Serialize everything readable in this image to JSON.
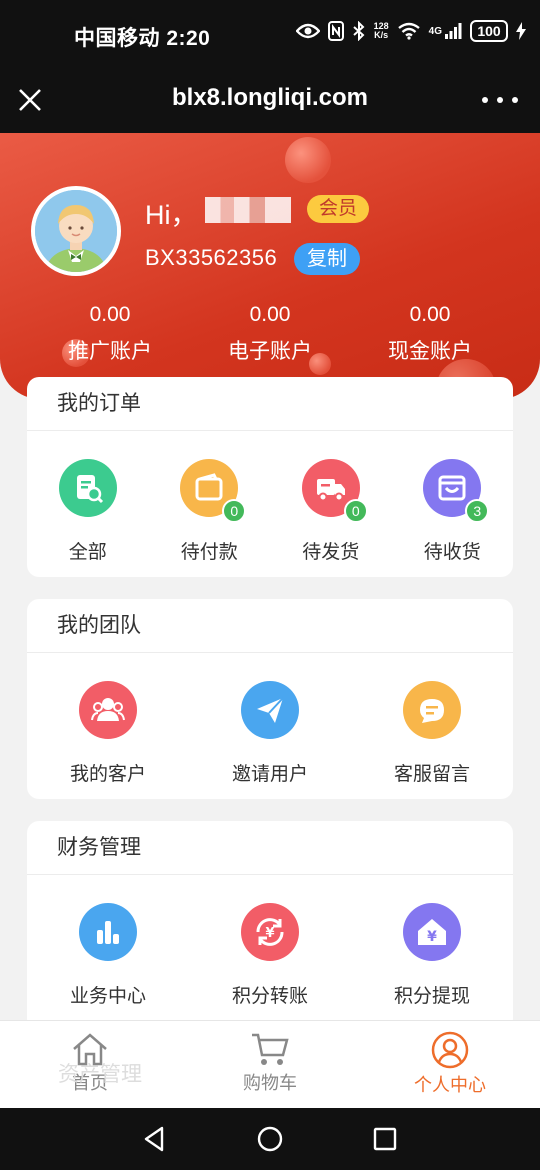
{
  "status_bar": {
    "carrier_time": "中国移动 2:20",
    "speed_top": "128",
    "speed_bottom": "K/s",
    "network": "4G",
    "battery": "100"
  },
  "browser": {
    "url": "blx8.longliqi.com"
  },
  "profile": {
    "greeting": "Hi，",
    "member_badge": "会员",
    "user_id": "BX33562356",
    "copy_label": "复制"
  },
  "accounts": [
    {
      "amount": "0.00",
      "label": "推广账户"
    },
    {
      "amount": "0.00",
      "label": "电子账户"
    },
    {
      "amount": "0.00",
      "label": "现金账户"
    }
  ],
  "orders": {
    "title": "我的订单",
    "items": [
      {
        "label": "全部",
        "icon": "order-search-icon",
        "color": "#3ccb8f"
      },
      {
        "label": "待付款",
        "icon": "wallet-icon",
        "color": "#f8b64a",
        "badge": "0"
      },
      {
        "label": "待发货",
        "icon": "delivery-truck-icon",
        "color": "#f25d67",
        "badge": "0"
      },
      {
        "label": "待收货",
        "icon": "shopping-bag-icon",
        "color": "#8477f0",
        "badge": "3"
      }
    ]
  },
  "team": {
    "title": "我的团队",
    "items": [
      {
        "label": "我的客户",
        "icon": "customers-icon",
        "color": "#f25d67"
      },
      {
        "label": "邀请用户",
        "icon": "paper-plane-icon",
        "color": "#4aa6ef"
      },
      {
        "label": "客服留言",
        "icon": "chat-message-icon",
        "color": "#f8b64a"
      }
    ]
  },
  "finance": {
    "title": "财务管理",
    "items": [
      {
        "label": "业务中心",
        "icon": "bar-chart-icon",
        "color": "#4aa6ef"
      },
      {
        "label": "积分转账",
        "icon": "yen-transfer-icon",
        "color": "#f25d67"
      },
      {
        "label": "积分提现",
        "icon": "yen-house-icon",
        "color": "#8477f0"
      }
    ]
  },
  "ghost_title": "资产管理",
  "bottom_nav": [
    {
      "label": "首页",
      "icon": "home-icon"
    },
    {
      "label": "购物车",
      "icon": "cart-icon"
    },
    {
      "label": "个人中心",
      "icon": "profile-icon",
      "active": true
    }
  ],
  "colors": {
    "header_red": "#d3351f",
    "accent_orange": "#ee6d2b",
    "badge_green": "#43b95a",
    "copy_blue": "#3ea0f5",
    "member_yellow": "#fcca3f"
  }
}
